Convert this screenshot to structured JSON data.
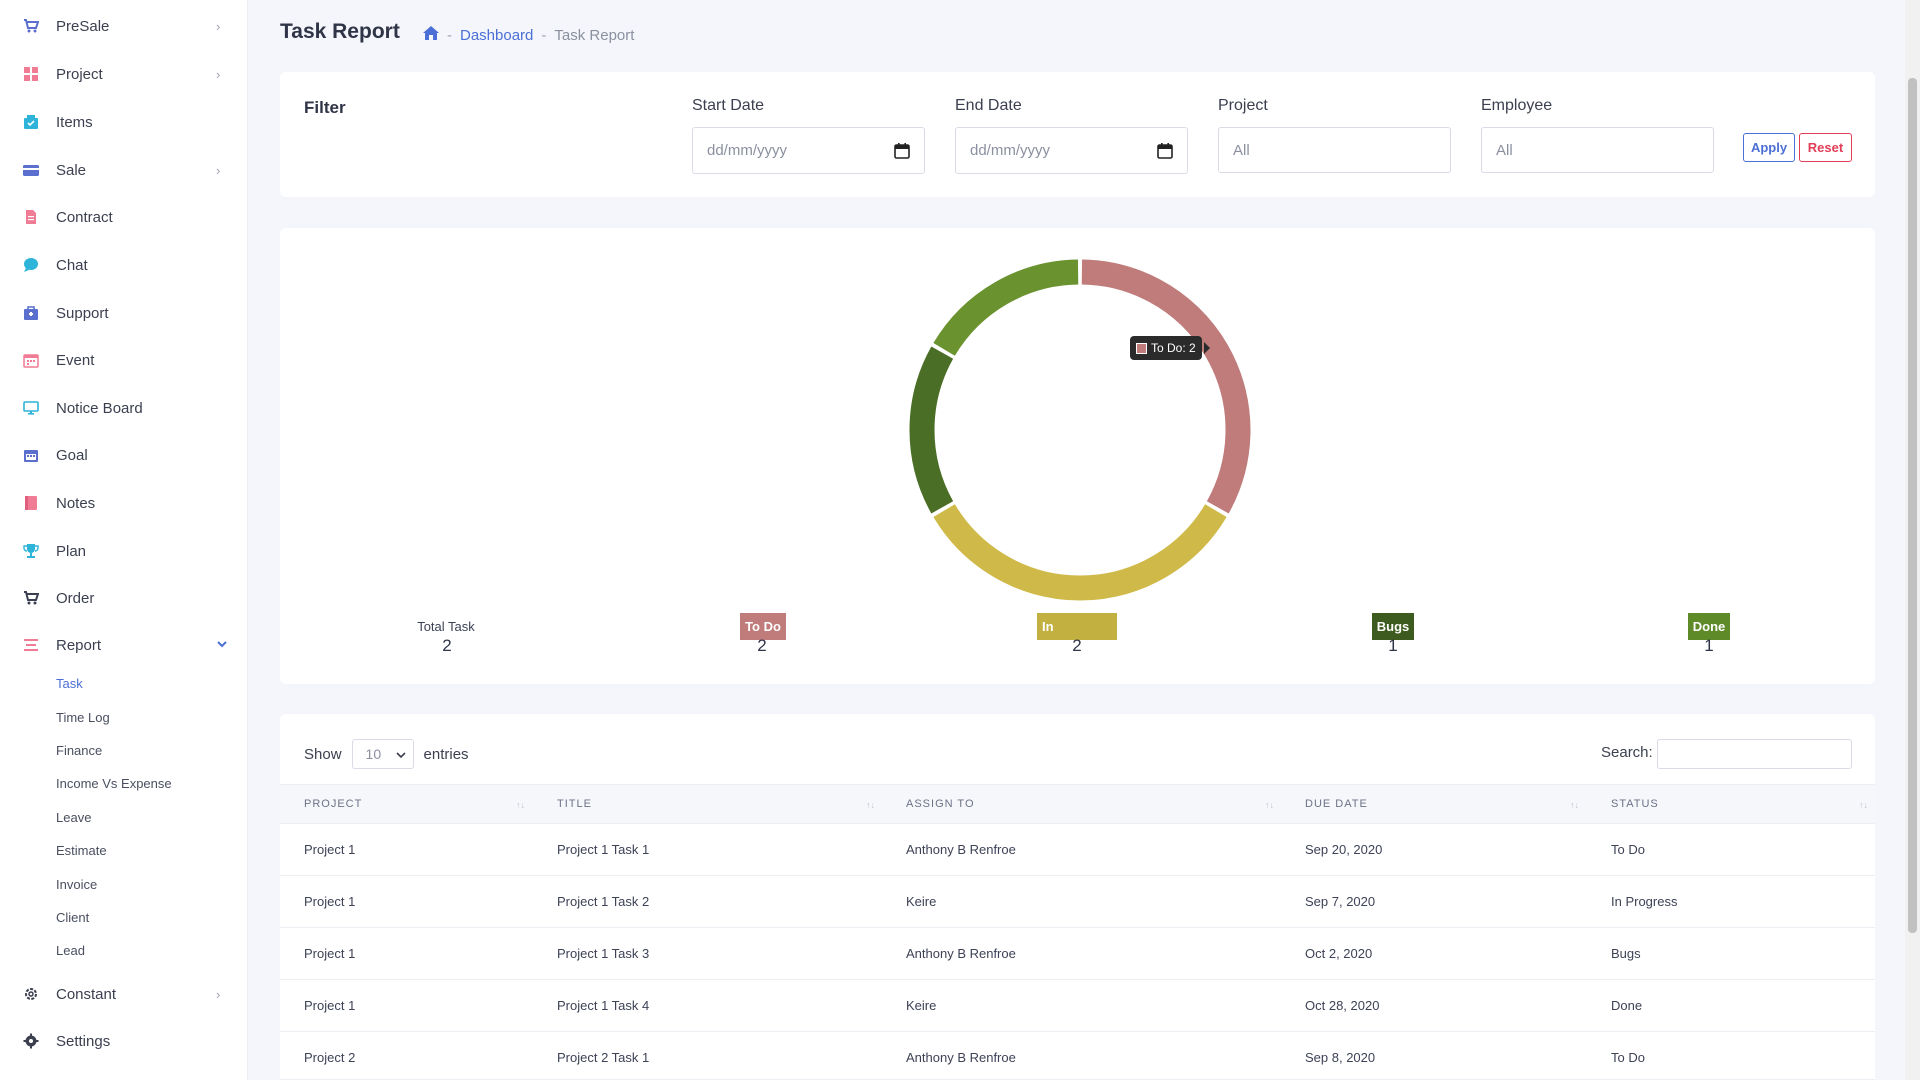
{
  "sidebar": {
    "items": [
      {
        "label": "PreSale",
        "icon": "cart-icon",
        "chevron": "›"
      },
      {
        "label": "Project",
        "icon": "grid-icon",
        "chevron": "›"
      },
      {
        "label": "Items",
        "icon": "items-icon",
        "chevron": ""
      },
      {
        "label": "Sale",
        "icon": "card-icon",
        "chevron": "›"
      },
      {
        "label": "Contract",
        "icon": "document-icon",
        "chevron": ""
      },
      {
        "label": "Chat",
        "icon": "chat-icon",
        "chevron": ""
      },
      {
        "label": "Support",
        "icon": "support-icon",
        "chevron": ""
      },
      {
        "label": "Event",
        "icon": "calendar-icon",
        "chevron": ""
      },
      {
        "label": "Notice Board",
        "icon": "monitor-icon",
        "chevron": ""
      },
      {
        "label": "Goal",
        "icon": "goal-calendar-icon",
        "chevron": ""
      },
      {
        "label": "Notes",
        "icon": "notes-icon",
        "chevron": ""
      },
      {
        "label": "Plan",
        "icon": "trophy-icon",
        "chevron": ""
      },
      {
        "label": "Order",
        "icon": "order-cart-icon",
        "chevron": ""
      },
      {
        "label": "Report",
        "icon": "report-icon",
        "chevron": "⌄"
      }
    ],
    "report_sub": [
      "Task",
      "Time Log",
      "Finance",
      "Income Vs Expense",
      "Leave",
      "Estimate",
      "Invoice",
      "Client",
      "Lead"
    ],
    "bottom_items": [
      {
        "label": "Constant",
        "icon": "gear-icon",
        "chevron": "›"
      },
      {
        "label": "Settings",
        "icon": "settings-icon",
        "chevron": ""
      }
    ]
  },
  "header": {
    "title": "Task Report",
    "breadcrumb": {
      "link": "Dashboard",
      "current": "Task Report",
      "separator": "-"
    }
  },
  "filter": {
    "title": "Filter",
    "start_date": {
      "label": "Start Date",
      "placeholder": "dd/mm/yyyy"
    },
    "end_date": {
      "label": "End Date",
      "placeholder": "dd/mm/yyyy"
    },
    "project": {
      "label": "Project",
      "value": "All"
    },
    "employee": {
      "label": "Employee",
      "value": "All"
    },
    "apply_label": "Apply",
    "reset_label": "Reset"
  },
  "chart_data": {
    "type": "pie",
    "variant": "donut",
    "categories": [
      "To Do",
      "In Progress",
      "Bugs",
      "Done"
    ],
    "values": [
      2,
      2,
      1,
      1
    ],
    "colors": [
      "#c07b7b",
      "#cfb948",
      "#4a6e25",
      "#6a922f"
    ],
    "tooltip": "To Do: 2"
  },
  "stats": {
    "total_label": "Total Task",
    "total_value": "2",
    "items": [
      {
        "label": "To Do",
        "value": "2",
        "color": "#c07b7b"
      },
      {
        "label": "In Progress",
        "value": "2",
        "color": "#c2b041"
      },
      {
        "label": "Bugs",
        "value": "1",
        "color": "#3d5b1e"
      },
      {
        "label": "Done",
        "value": "1",
        "color": "#5f8a28"
      }
    ]
  },
  "table": {
    "show_label": "Show",
    "entries_value": "10",
    "entries_label": "entries",
    "search_label": "Search:",
    "columns": [
      "Project",
      "Title",
      "Assign To",
      "Due Date",
      "Status"
    ],
    "rows": [
      [
        "Project 1",
        "Project 1 Task 1",
        "Anthony B Renfroe",
        "Sep 20, 2020",
        "To Do"
      ],
      [
        "Project 1",
        "Project 1 Task 2",
        "Keire",
        "Sep 7, 2020",
        "In Progress"
      ],
      [
        "Project 1",
        "Project 1 Task 3",
        "Anthony B Renfroe",
        "Oct 2, 2020",
        "Bugs"
      ],
      [
        "Project 1",
        "Project 1 Task 4",
        "Keire",
        "Oct 28, 2020",
        "Done"
      ],
      [
        "Project 2",
        "Project 2 Task 1",
        "Anthony B Renfroe",
        "Sep 8, 2020",
        "To Do"
      ]
    ]
  },
  "colors": {
    "accent": "#4b6fd6",
    "danger": "#e23e57"
  }
}
